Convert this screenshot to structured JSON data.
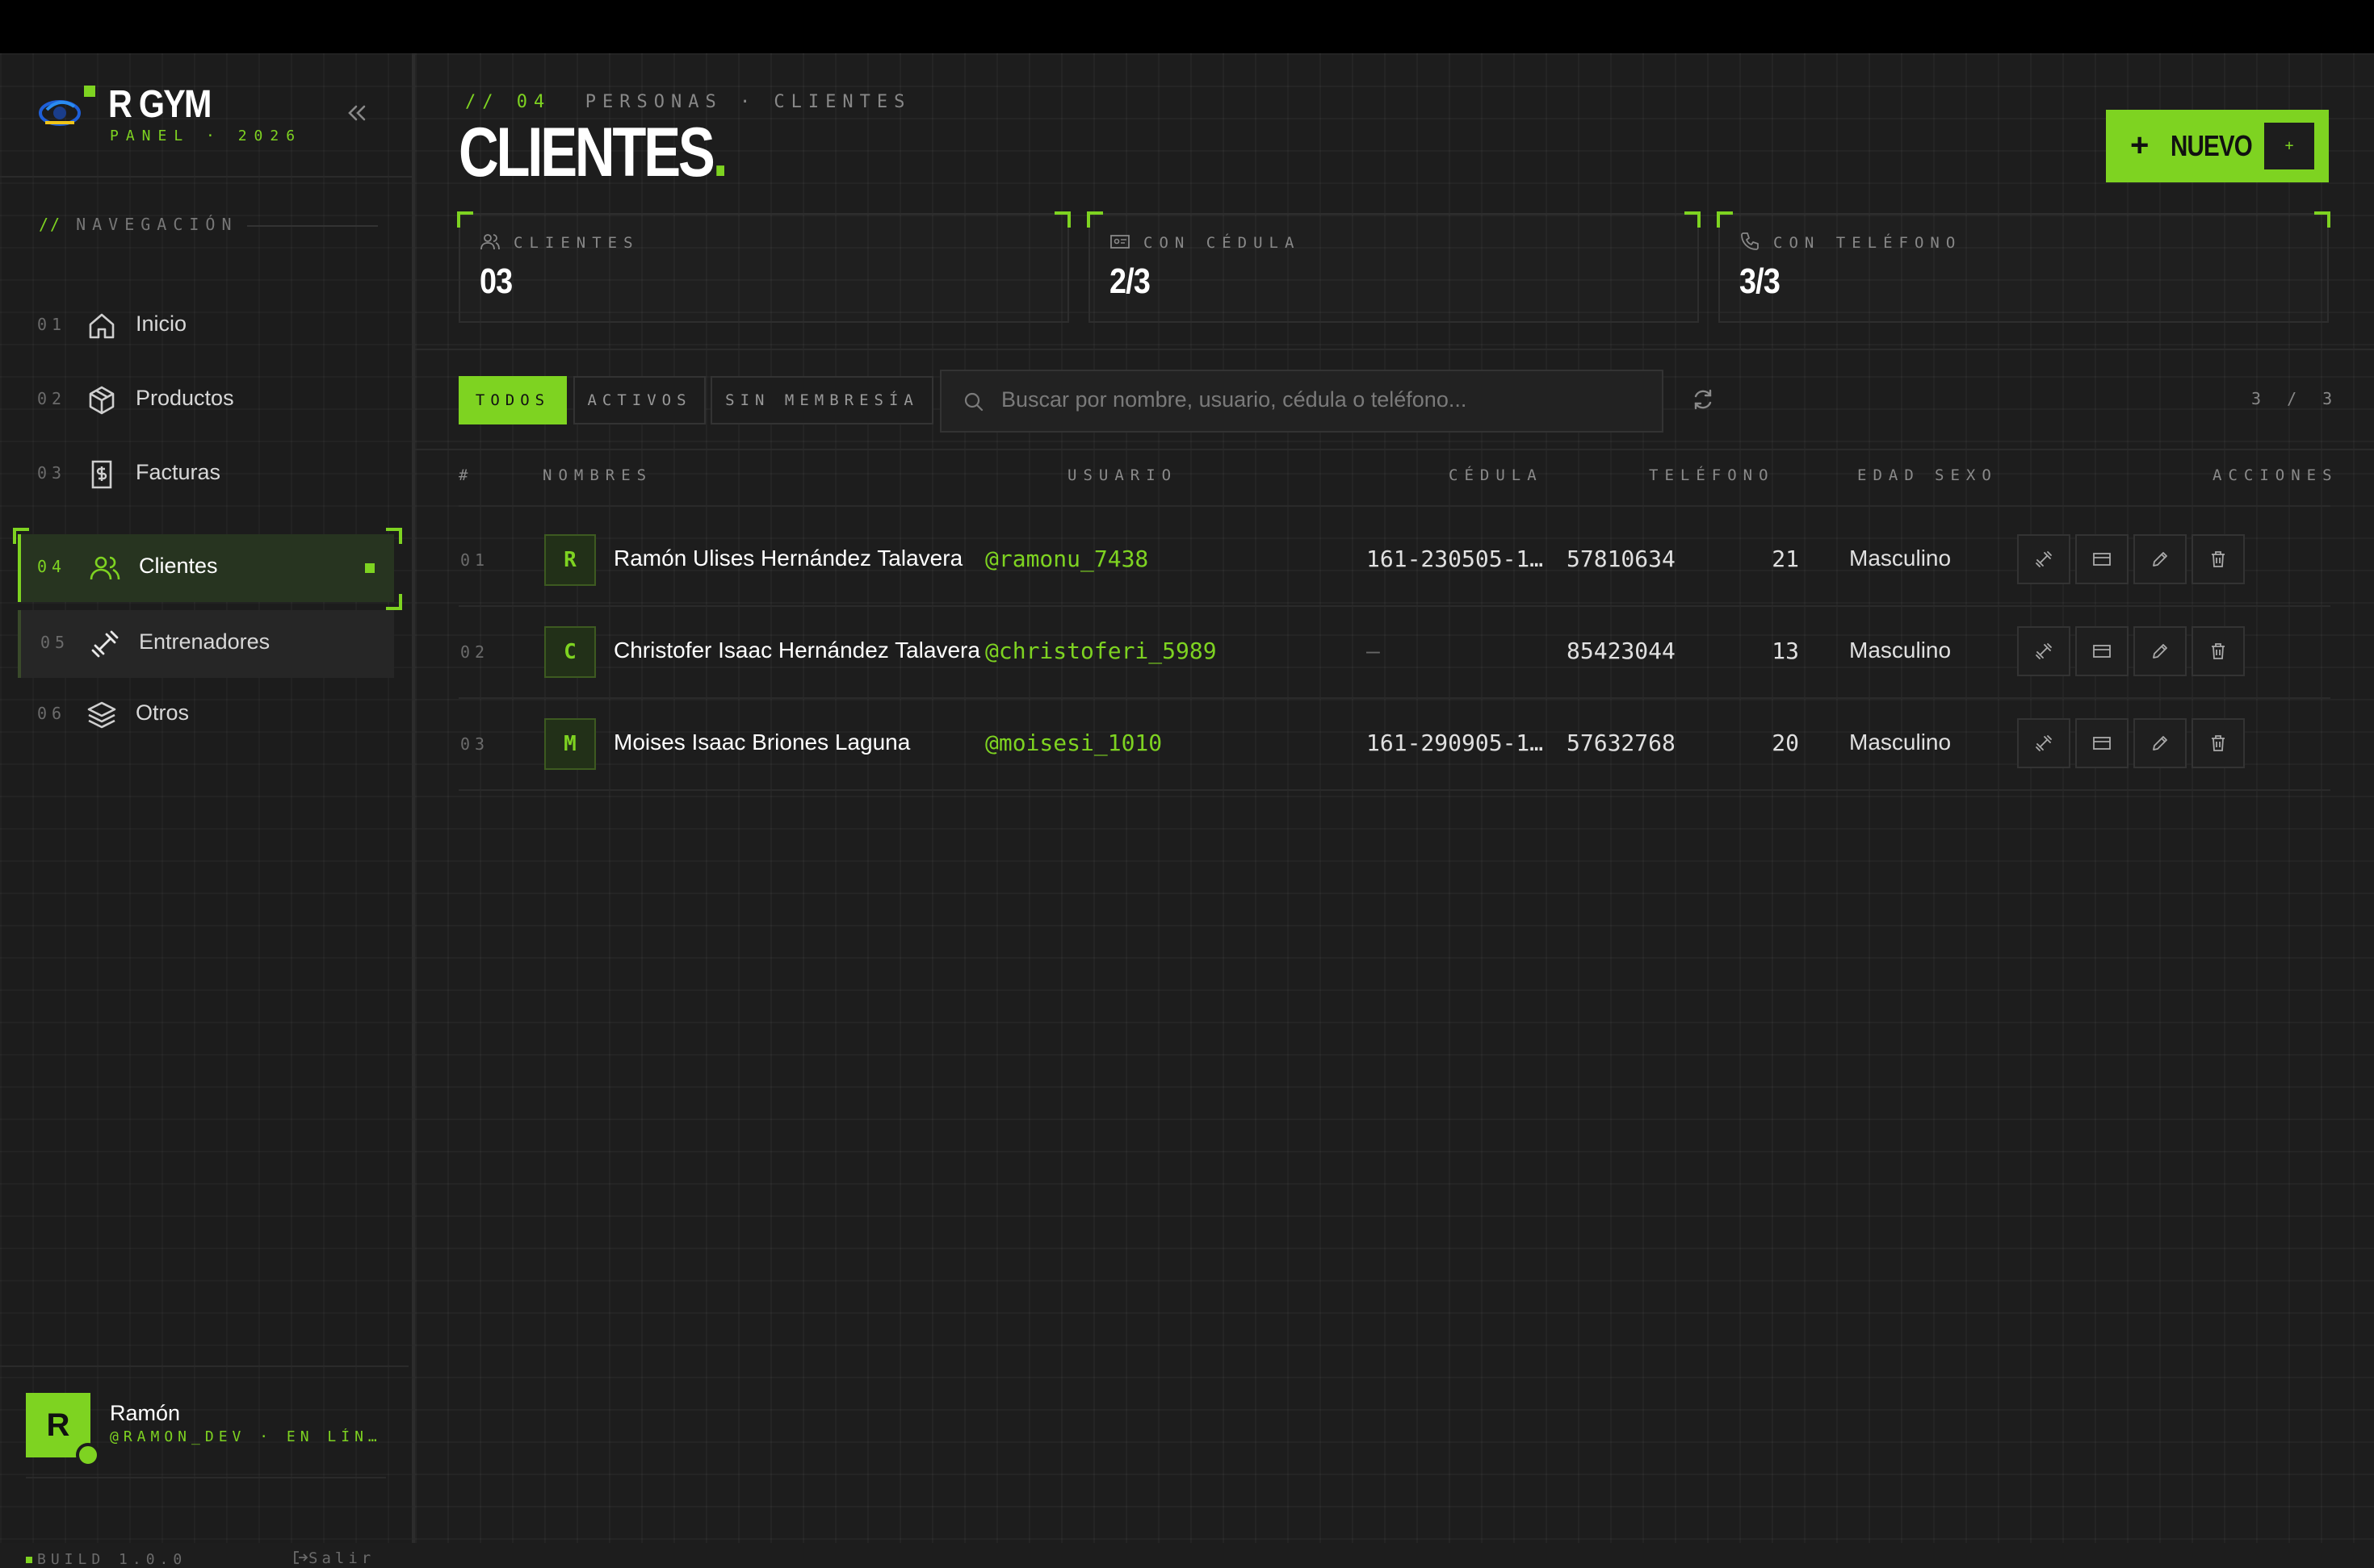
{
  "brand": {
    "title": "R GYM",
    "subtitle": "PANEL · 2026",
    "logo_text": "RGYM"
  },
  "sidebar": {
    "nav_title_prefix": "//",
    "nav_title": "NAVEGACIÓN",
    "items": [
      {
        "num": "01",
        "label": "Inicio",
        "icon": "home-icon"
      },
      {
        "num": "02",
        "label": "Productos",
        "icon": "box-icon"
      },
      {
        "num": "03",
        "label": "Facturas",
        "icon": "invoice-icon"
      },
      {
        "num": "04",
        "label": "Clientes",
        "icon": "users-icon",
        "active": true
      },
      {
        "num": "05",
        "label": "Entrenadores",
        "icon": "dumbbell-icon"
      },
      {
        "num": "06",
        "label": "Otros",
        "icon": "layers-icon"
      }
    ]
  },
  "user": {
    "initial": "R",
    "name": "Ramón",
    "handle": "@RAMON_DEV · EN LÍN…"
  },
  "footer": {
    "build": "BUILD 1.0.0",
    "logout": "Salir"
  },
  "header": {
    "crumb_prefix": "// 04",
    "crumb": "PERSONAS · CLIENTES",
    "title": "CLIENTES",
    "title_dot": ".",
    "new_button": "NUEVO",
    "new_button_plus": "+",
    "new_button_shortcut": "+"
  },
  "stats": [
    {
      "label": "CLIENTES",
      "value": "03",
      "icon": "users-icon"
    },
    {
      "label": "CON CÉDULA",
      "value": "2/3",
      "icon": "id-card-icon"
    },
    {
      "label": "CON TELÉFONO",
      "value": "3/3",
      "icon": "phone-icon"
    }
  ],
  "filters": [
    {
      "label": "TODOS",
      "active": true
    },
    {
      "label": "ACTIVOS",
      "active": false
    },
    {
      "label": "SIN MEMBRESÍA",
      "active": false
    }
  ],
  "search": {
    "placeholder": "Buscar por nombre, usuario, cédula o teléfono..."
  },
  "result_count": "3 / 3",
  "table": {
    "columns": [
      "#",
      "NOMBRES",
      "USUARIO",
      "CÉDULA",
      "TELÉFONO",
      "EDAD",
      "SEXO",
      "ACCIONES"
    ],
    "rows": [
      {
        "idx": "01",
        "initial": "R",
        "name": "Ramón Ulises Hernández Talavera",
        "user": "@ramonu_7438",
        "cedula": "161-230505-1…",
        "telefono": "57810634",
        "edad": "21",
        "sexo": "Masculino"
      },
      {
        "idx": "02",
        "initial": "C",
        "name": "Christofer Isaac Hernández Talavera",
        "user": "@christoferi_5989",
        "cedula": "—",
        "telefono": "85423044",
        "edad": "13",
        "sexo": "Masculino"
      },
      {
        "idx": "03",
        "initial": "M",
        "name": "Moises Isaac Briones Laguna",
        "user": "@moisesi_1010",
        "cedula": "161-290905-1…",
        "telefono": "57632768",
        "edad": "20",
        "sexo": "Masculino"
      }
    ],
    "row_actions": [
      "dumbbell-icon",
      "card-icon",
      "pencil-icon",
      "trash-icon"
    ]
  },
  "colors": {
    "accent": "#7ed321",
    "background": "#1d1d1d",
    "topbar": "#000000"
  }
}
